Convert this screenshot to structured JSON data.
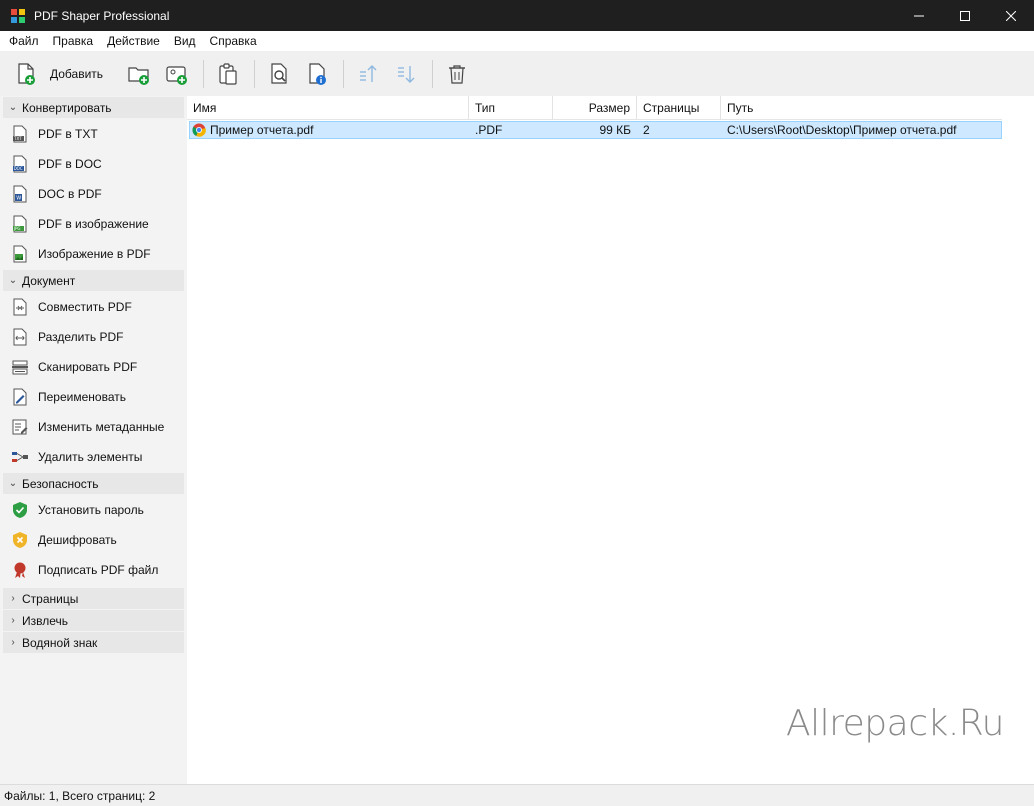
{
  "window": {
    "title": "PDF Shaper Professional"
  },
  "menu": [
    "Файл",
    "Правка",
    "Действие",
    "Вид",
    "Справка"
  ],
  "toolbar": {
    "add_label": "Добавить",
    "buttons": [
      "add-file",
      "add-folder",
      "add-image",
      "paste",
      "preview",
      "info",
      "move-up",
      "move-down",
      "delete"
    ]
  },
  "sidebar": {
    "groups": [
      {
        "label": "Конвертировать",
        "expanded": true,
        "items": [
          {
            "label": "PDF в TXT",
            "icon": "txt-file-icon"
          },
          {
            "label": "PDF в DOC",
            "icon": "doc-file-icon"
          },
          {
            "label": "DOC в PDF",
            "icon": "word-file-icon"
          },
          {
            "label": "PDF в изображение",
            "icon": "jpg-file-icon"
          },
          {
            "label": "Изображение в PDF",
            "icon": "image-file-icon"
          }
        ]
      },
      {
        "label": "Документ",
        "expanded": true,
        "items": [
          {
            "label": "Совместить PDF",
            "icon": "merge-icon"
          },
          {
            "label": "Разделить PDF",
            "icon": "split-icon"
          },
          {
            "label": "Сканировать PDF",
            "icon": "scanner-icon"
          },
          {
            "label": "Переименовать",
            "icon": "rename-icon"
          },
          {
            "label": "Изменить метаданные",
            "icon": "metadata-icon"
          },
          {
            "label": "Удалить элементы",
            "icon": "remove-elements-icon"
          }
        ]
      },
      {
        "label": "Безопасность",
        "expanded": true,
        "items": [
          {
            "label": "Установить пароль",
            "icon": "shield-check-icon"
          },
          {
            "label": "Дешифровать",
            "icon": "shield-x-icon"
          },
          {
            "label": "Подписать PDF файл",
            "icon": "seal-icon"
          }
        ]
      },
      {
        "label": "Страницы",
        "expanded": false,
        "items": []
      },
      {
        "label": "Извлечь",
        "expanded": false,
        "items": []
      },
      {
        "label": "Водяной знак",
        "expanded": false,
        "items": []
      }
    ]
  },
  "columns": [
    "Имя",
    "Тип",
    "Размер",
    "Страницы",
    "Путь"
  ],
  "files": [
    {
      "name": "Пример отчета.pdf",
      "type": ".PDF",
      "size": "99 КБ",
      "pages": "2",
      "path": "C:\\Users\\Root\\Desktop\\Пример отчета.pdf"
    }
  ],
  "watermark": "Allrepack.Ru",
  "status": "Файлы: 1, Всего страниц: 2"
}
